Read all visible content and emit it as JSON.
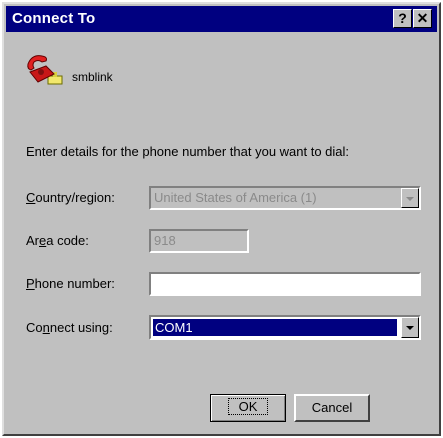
{
  "window": {
    "title": "Connect To",
    "help_button": "?",
    "close_button": "✕"
  },
  "connection": {
    "name": "smblink",
    "icon": "phone-icon"
  },
  "instructions": "Enter details for the phone number that you want to dial:",
  "fields": {
    "country": {
      "label_mnemonic": "C",
      "label_rest": "ountry/region:",
      "value": "United States of America (1)",
      "enabled": false
    },
    "area_code": {
      "label_pre": "Ar",
      "label_mnemonic": "e",
      "label_rest": "a code:",
      "value": "918",
      "enabled": false
    },
    "phone_number": {
      "label_mnemonic": "P",
      "label_rest": "hone number:",
      "value": "",
      "enabled": true
    },
    "connect_using": {
      "label_pre": "Co",
      "label_mnemonic": "n",
      "label_rest": "nect using:",
      "value": "COM1",
      "enabled": true
    }
  },
  "buttons": {
    "ok": "OK",
    "cancel": "Cancel"
  },
  "colors": {
    "titlebar": "#000080",
    "face": "#c0c0c0",
    "selection": "#000080"
  }
}
